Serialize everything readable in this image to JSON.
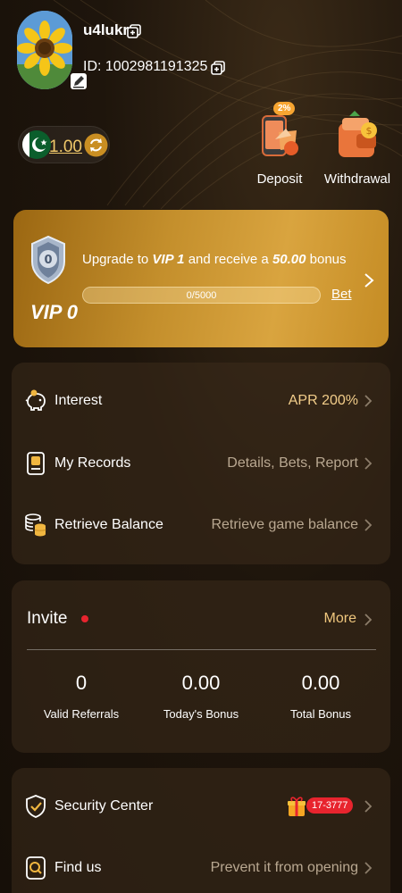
{
  "colors": {
    "accent": "#f0c86a",
    "vip_gold": "#d9a43f",
    "badge_red": "#e8242e",
    "bg": "#1b130c"
  },
  "profile": {
    "username": "u4lukr",
    "id_text": "ID: 1002981191325"
  },
  "wallet": {
    "balance": "1.00",
    "flag": "pakistan-flag-icon"
  },
  "actions": [
    {
      "label": "Deposit",
      "badge": "2%",
      "icon": "deposit-icon"
    },
    {
      "label": "Withdrawal",
      "icon": "withdrawal-icon"
    }
  ],
  "vip": {
    "level": "VIP 0",
    "upgrade_prefix": "Upgrade to ",
    "upgrade_target": "VIP 1",
    "upgrade_middle": " and receive a ",
    "upgrade_amount": "50.00",
    "upgrade_suffix": " bonus",
    "progress_text": "0/5000",
    "progress_fraction": 0,
    "bet_label": "Bet"
  },
  "menu1": [
    {
      "label": "Interest",
      "value": "APR 200%",
      "icon": "piggy-bank-icon"
    },
    {
      "label": "My Records",
      "value": "Details, Bets, Report",
      "icon": "records-icon"
    },
    {
      "label": "Retrieve Balance",
      "value": "Retrieve game balance",
      "icon": "coins-stack-icon"
    }
  ],
  "invite": {
    "title": "Invite",
    "more_label": "More",
    "stats": [
      {
        "value": "0",
        "caption": "Valid Referrals"
      },
      {
        "value": "0.00",
        "caption": "Today's Bonus"
      },
      {
        "value": "0.00",
        "caption": "Total Bonus"
      }
    ]
  },
  "menu2": [
    {
      "label": "Security Center",
      "badge": "17-3777",
      "icon": "shield-check-icon"
    },
    {
      "label": "Find us",
      "value": "Prevent it from opening",
      "icon": "search-doc-icon"
    }
  ]
}
